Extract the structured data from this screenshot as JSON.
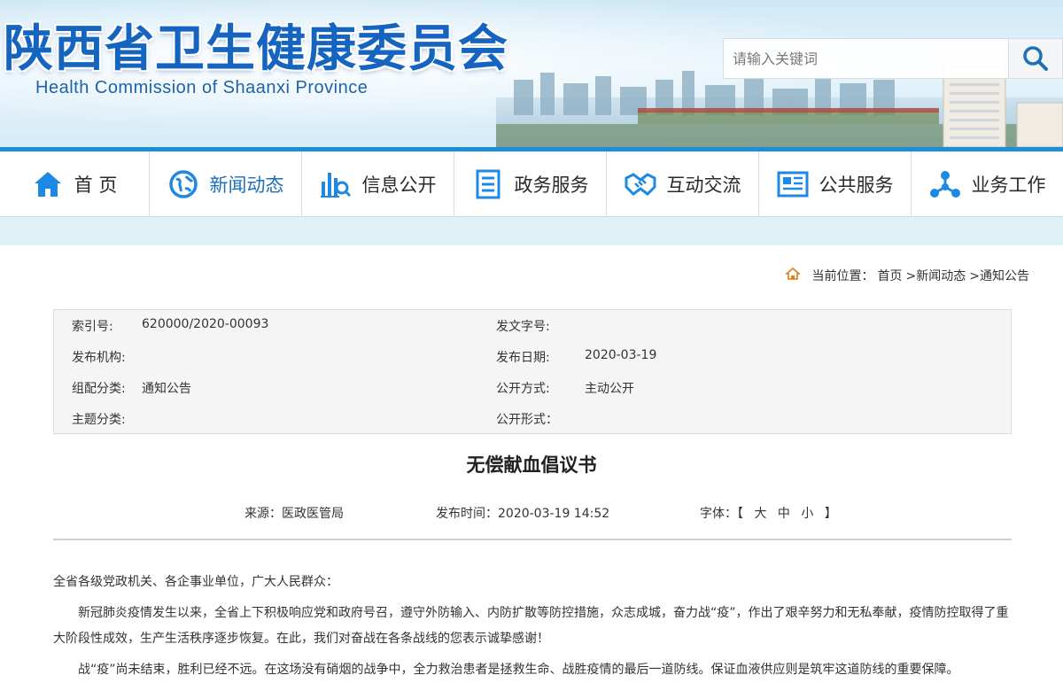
{
  "header": {
    "title_cn": "陕西省卫生健康委员会",
    "title_en": "Health Commission of Shaanxi Province",
    "search_placeholder": "请输入关键词"
  },
  "nav": [
    {
      "label": "首 页",
      "icon": "home-icon"
    },
    {
      "label": "新闻动态",
      "icon": "globe-icon"
    },
    {
      "label": "信息公开",
      "icon": "chart-search-icon"
    },
    {
      "label": "政务服务",
      "icon": "document-icon"
    },
    {
      "label": "互动交流",
      "icon": "handshake-icon"
    },
    {
      "label": "公共服务",
      "icon": "newspaper-icon"
    },
    {
      "label": "业务工作",
      "icon": "network-icon"
    }
  ],
  "breadcrumb": {
    "prefix": "当前位置：",
    "items": [
      "首页",
      ">新闻动态",
      ">通知公告"
    ]
  },
  "meta": {
    "index_label": "索引号:",
    "index_value": "620000/2020-00093",
    "doc_no_label": "发文字号:",
    "doc_no_value": "",
    "org_label": "发布机构:",
    "org_value": "",
    "date_label": "发布日期:",
    "date_value": "2020-03-19",
    "category_label": "组配分类:",
    "category_value": "通知公告",
    "open_mode_label": "公开方式:",
    "open_mode_value": "主动公开",
    "topic_label": "主题分类:",
    "topic_value": "",
    "open_form_label": "公开形式：",
    "open_form_value": ""
  },
  "article": {
    "title": "无偿献血倡议书",
    "source": "来源：医政医管局",
    "publish_time": "发布时间：2020-03-19 14:52",
    "font_label": "字体：",
    "font_sizes": "【 大 中 小 】",
    "paragraphs": [
      "全省各级党政机关、各企事业单位，广大人民群众：",
      "新冠肺炎疫情发生以来，全省上下积极响应党和政府号召，遵守外防输入、内防扩散等防控措施，众志成城，奋力战“疫”，作出了艰辛努力和无私奉献，疫情防控取得了重大阶段性成效，生产生活秩序逐步恢复。在此，我们对奋战在各条战线的您表示诚挚感谢！",
      "战“疫”尚未结束，胜利已经不远。在这场没有硝烟的战争中，全力救治患者是拯救生命、战胜疫情的最后一道防线。保证血液供应则是筑牢这道防线的重要保障。"
    ]
  },
  "colors": {
    "brand_blue": "#1565c0",
    "nav_icon_blue": "#1e88e5",
    "accent_bar": "#1d8fd8"
  }
}
